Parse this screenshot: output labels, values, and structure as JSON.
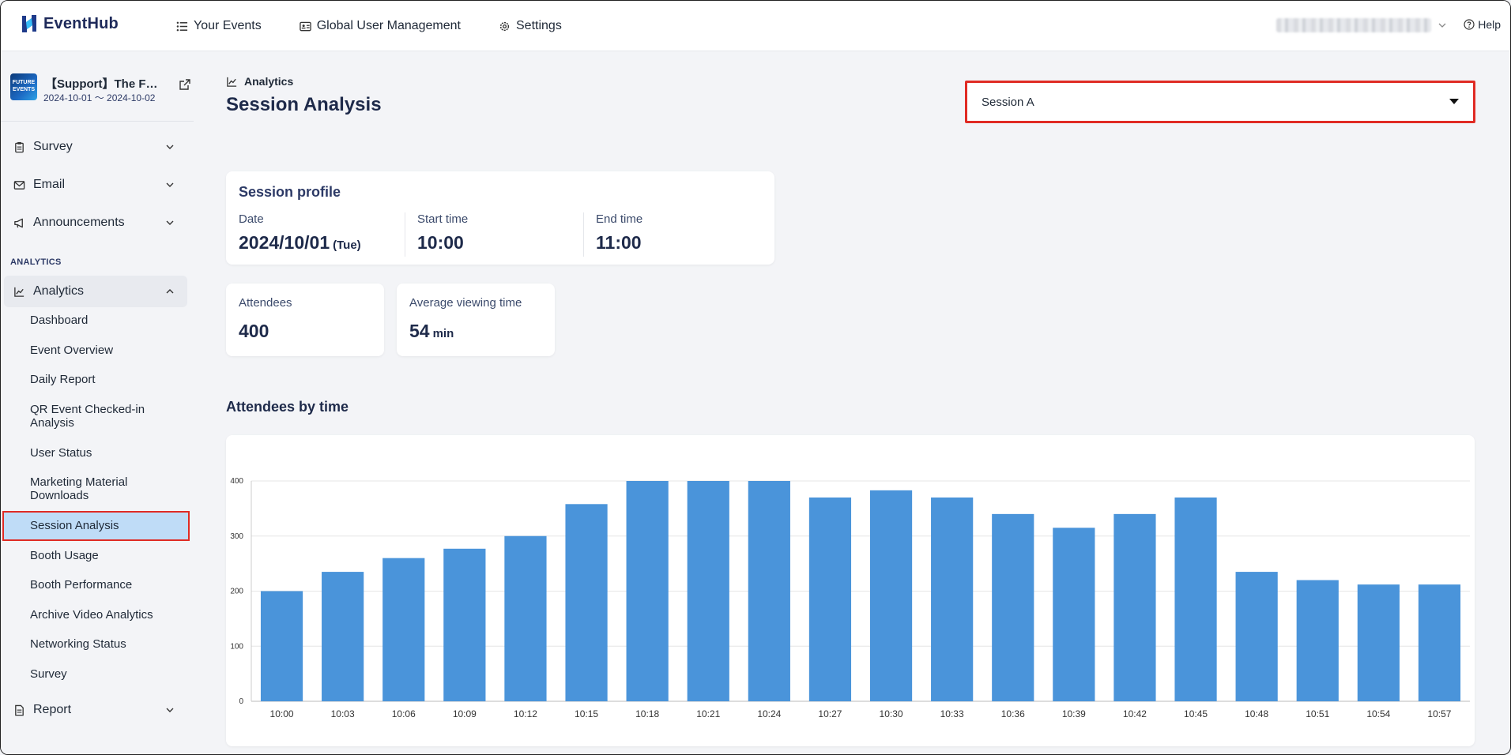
{
  "app": {
    "name": "EventHub"
  },
  "nav": {
    "your_events": "Your Events",
    "global_user_management": "Global User Management",
    "settings": "Settings"
  },
  "help": "Help",
  "event": {
    "title": "【Support】The F…",
    "dates": "2024-10-01 ～ 2024-10-02",
    "thumb_text": "FUTURE EVENTS"
  },
  "sidebar": {
    "survey": "Survey",
    "email": "Email",
    "announcements": "Announcements",
    "section_analytics": "ANALYTICS",
    "analytics": "Analytics",
    "report": "Report",
    "analytics_items": [
      "Dashboard",
      "Event Overview",
      "Daily Report",
      "QR Event Checked-in Analysis",
      "User Status",
      "Marketing Material Downloads",
      "Session Analysis",
      "Booth Usage",
      "Booth Performance",
      "Archive Video Analytics",
      "Networking Status",
      "Survey"
    ]
  },
  "main": {
    "breadcrumb": "Analytics",
    "title": "Session Analysis",
    "session_select": {
      "value": "Session A"
    },
    "profile": {
      "title": "Session profile",
      "date_label": "Date",
      "date_value": "2024/10/01",
      "date_day": "(Tue)",
      "start_label": "Start time",
      "start_value": "10:00",
      "end_label": "End time",
      "end_value": "11:00"
    },
    "attendees": {
      "label": "Attendees",
      "value": "400"
    },
    "avg_viewing": {
      "label": "Average viewing time",
      "value": "54",
      "unit": "min"
    },
    "chart_title": "Attendees by time"
  },
  "colors": {
    "bar": "#4a94da",
    "highlight": "#e02b24",
    "selected_bg": "#bfdcf7"
  },
  "chart_data": {
    "type": "bar",
    "title": "Attendees by time",
    "categories": [
      "10:00",
      "10:03",
      "10:06",
      "10:09",
      "10:12",
      "10:15",
      "10:18",
      "10:21",
      "10:24",
      "10:27",
      "10:30",
      "10:33",
      "10:36",
      "10:39",
      "10:42",
      "10:45",
      "10:48",
      "10:51",
      "10:54",
      "10:57"
    ],
    "values": [
      200,
      235,
      260,
      277,
      300,
      358,
      400,
      400,
      400,
      370,
      383,
      370,
      340,
      315,
      340,
      370,
      235,
      220,
      212,
      212
    ],
    "ylim": [
      0,
      400
    ],
    "yticks": [
      0,
      100,
      200,
      300,
      400
    ],
    "grid": true
  }
}
